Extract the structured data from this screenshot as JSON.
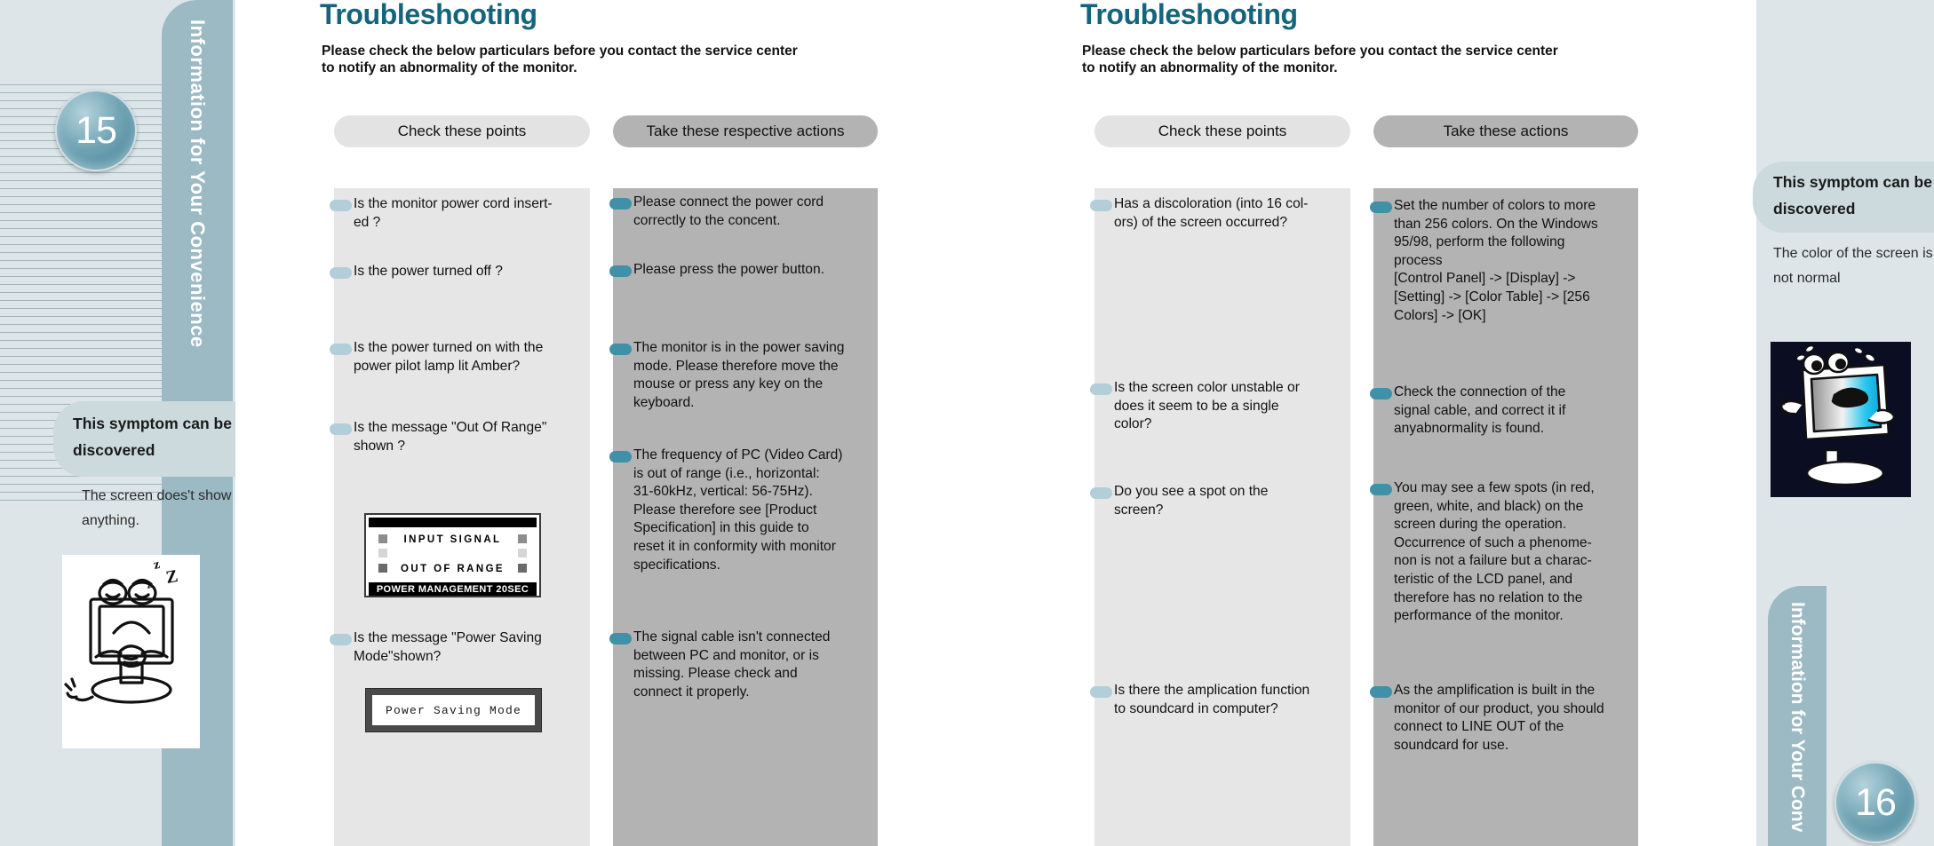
{
  "left_page": {
    "page_number": "15",
    "vertical_tab": "Information for Your Convenience",
    "title": "Troubleshooting",
    "subtitle": "Please check  the below  particulars before   you contact the  service center\nto notify an abnormality of the monitor.",
    "column_headers": {
      "check": "Check these points",
      "action": "Take these respective actions"
    },
    "checks": [
      {
        "text": "Is the monitor power cord insert-\ned ?"
      },
      {
        "text": "Is the power turned off ?"
      },
      {
        "text": "Is the power turned on with the\npower pilot lamp lit  Amber?"
      },
      {
        "text": "Is the message \"Out Of Range\"\nshown ?"
      },
      {
        "text": "Is the message \"Power Saving\nMode\"shown?"
      }
    ],
    "actions": [
      {
        "text": "Please connect the power cord\ncorrectly to the concent."
      },
      {
        "text": "Please press the power button."
      },
      {
        "text": "The monitor is in the power saving\nmode. Please  therefore move the\nmouse or press any key on the\nkeyboard."
      },
      {
        "text": "The frequency of PC (Video Card)\nis out of range (i.e.,  horizontal:\n31-60kHz, vertical: 56-75Hz).\nPlease therefore see [Product\nSpecification] in  this guide to\nreset it in conformity with monitor\nspecifications."
      },
      {
        "text": "The  signal cable  isn't connected\nbetween PC  and monitor,  or is\nmissing. Please check and\nconnect it properly."
      }
    ],
    "osd_out_of_range": {
      "line1": "INPUT SIGNAL",
      "line2": "OUT OF RANGE",
      "footer": "POWER MANAGEMENT 20SEC"
    },
    "osd_power_saving": {
      "text": "Power Saving Mode"
    },
    "symptom_box": {
      "heading": "This symptom can\nbe discovered",
      "description": "The screen does't\nshow anything."
    }
  },
  "right_page": {
    "page_number": "16",
    "vertical_tab": "Information for Your Conv",
    "title": "Troubleshooting",
    "subtitle": "Please check  the below  particulars before   you contact the  service center\nto notify an abnormality of the monitor.",
    "column_headers": {
      "check": "Check these points",
      "action": "Take these actions"
    },
    "checks": [
      {
        "text": "Has a discoloration (into 16 col-\nors) of the screen occurred?"
      },
      {
        "text": "Is the screen color unstable or\ndoes it seem to be a single\ncolor?"
      },
      {
        "text": "Do you see a spot on the\nscreen?"
      },
      {
        "text": "Is there the amplication function\nto soundcard in computer?"
      }
    ],
    "actions": [
      {
        "text": "Set the number of colors to more\nthan 256 colors. On the Windows\n95/98, perform the following\nprocess\n[Control Panel] -> [Display] ->\n[Setting] -> [Color  Table] -> [256\nColors] -> [OK]"
      },
      {
        "text": "Check the connection of  the\nsignal cable,  and correct it  if\nanyabnormality  is found."
      },
      {
        "text": "You may see a few spots (in red,\ngreen, white, and black) on the\nscreen during the operation.\nOccurrence of  such a phenome-\nnon is  not  a  failure  but  a charac-\nteristic of the LCD panel, and\ntherefore has no relation to the\nperformance of the monitor."
      },
      {
        "text": "As the amplification is built in the\nmonitor of our product, you should\nconnect to LINE OUT of the\nsoundcard for use."
      }
    ],
    "symptom_box": {
      "heading": "This symptom can\nbe discovered",
      "description": "The color of the screen\nis not normal"
    }
  },
  "colors": {
    "title_teal": "#14657c",
    "tab_blue": "#9bbac4",
    "sidebar_bg": "#dde5e8",
    "col_light": "#e6e6e6",
    "col_dark": "#b3b3b3",
    "bullet_pale": "#b2ced9",
    "bullet_teal": "#4090a8"
  }
}
